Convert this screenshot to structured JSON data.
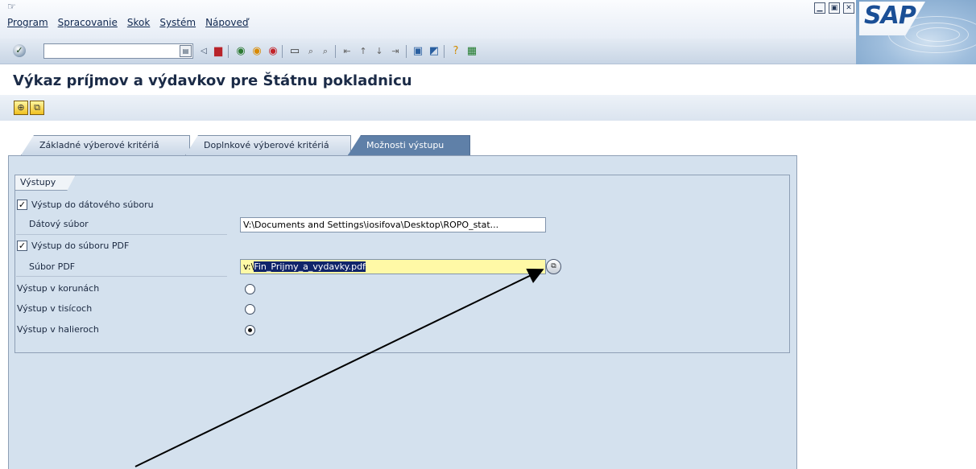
{
  "window": {
    "menu": [
      "Program",
      "Spracovanie",
      "Skok",
      "Systém",
      "Nápoveď"
    ],
    "logo_text": "SAP",
    "controls": [
      "minimize-icon",
      "maximize-icon",
      "close-icon"
    ]
  },
  "toolbar": {
    "command_value": "",
    "icons": [
      "enter-icon",
      "back-icon",
      "save-icon",
      "back-nav-icon",
      "exit-icon",
      "cancel-icon",
      "print-icon",
      "find-icon",
      "find-next-icon",
      "first-page-icon",
      "previous-page-icon",
      "next-page-icon",
      "last-page-icon",
      "create-session-icon",
      "shortcut-icon",
      "help-icon",
      "customize-layout-icon"
    ]
  },
  "title": "Výkaz príjmov a výdavkov pre Štátnu pokladnicu",
  "app_toolbar": {
    "buttons": [
      "execute-icon",
      "variant-icon"
    ]
  },
  "tabs": [
    {
      "label": "Základné výberové kritériá",
      "active": false
    },
    {
      "label": "Doplnkové výberové kritériá",
      "active": false
    },
    {
      "label": "Možnosti výstupu",
      "active": true
    }
  ],
  "group": {
    "label": "Výstupy",
    "output_file_checkbox": {
      "label": "Výstup do dátového súboru",
      "checked": true
    },
    "data_file": {
      "label": "Dátový súbor",
      "value": "V:\\Documents and Settings\\iosifova\\Desktop\\ROPO_stat..."
    },
    "pdf_checkbox": {
      "label": "Výstup do súboru PDF",
      "checked": true
    },
    "pdf_file": {
      "label": "Súbor PDF",
      "prefix": "v:\\",
      "selected": "Fin_Prijmy_a_vydavky.pdf"
    },
    "radio_options": [
      {
        "label": "Výstup v korunách",
        "selected": false
      },
      {
        "label": "Výstup v tisícoch",
        "selected": false
      },
      {
        "label": "Výstup v halieroch",
        "selected": true
      }
    ]
  },
  "colors": {
    "accent": "#5f80a8",
    "panel": "#d4e1ee",
    "input_required": "#fff9a6",
    "selection": "#10246a"
  }
}
